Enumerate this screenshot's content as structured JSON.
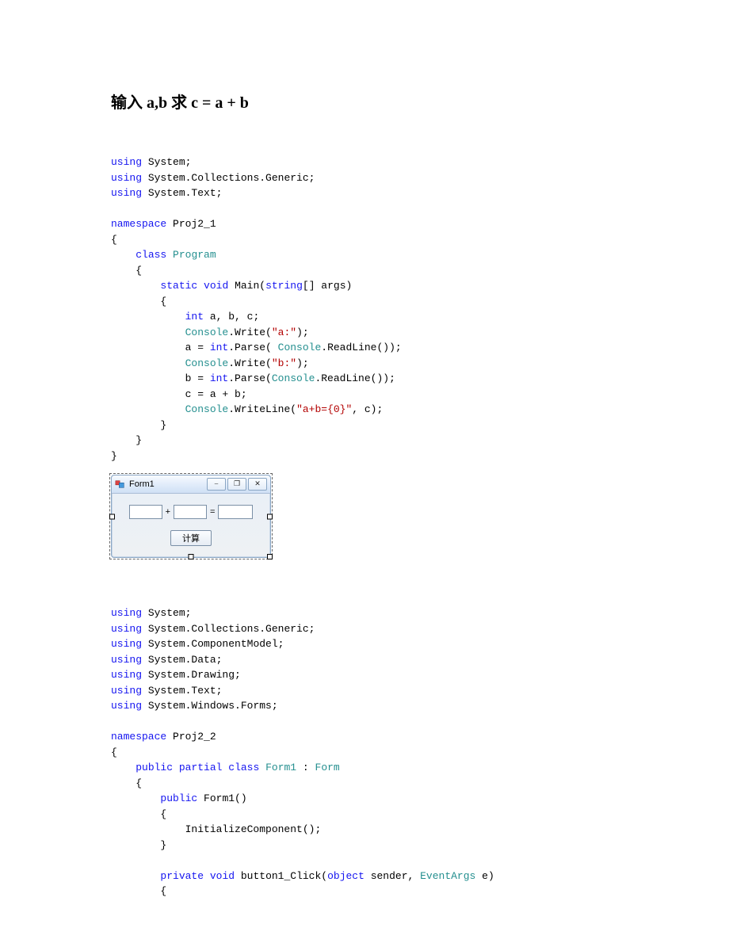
{
  "heading": "输入 a,b 求 c = a + b",
  "code1": {
    "lines": [
      [
        [
          "kw",
          "using"
        ],
        [
          "txt",
          " System;"
        ]
      ],
      [
        [
          "kw",
          "using"
        ],
        [
          "txt",
          " System.Collections.Generic;"
        ]
      ],
      [
        [
          "kw",
          "using"
        ],
        [
          "txt",
          " System.Text;"
        ]
      ],
      [
        [
          "txt",
          ""
        ]
      ],
      [
        [
          "kw",
          "namespace"
        ],
        [
          "txt",
          " Proj2_1"
        ]
      ],
      [
        [
          "txt",
          "{"
        ]
      ],
      [
        [
          "txt",
          "    "
        ],
        [
          "kw",
          "class"
        ],
        [
          "txt",
          " "
        ],
        [
          "typ",
          "Program"
        ]
      ],
      [
        [
          "txt",
          "    {"
        ]
      ],
      [
        [
          "txt",
          "        "
        ],
        [
          "kw",
          "static"
        ],
        [
          "txt",
          " "
        ],
        [
          "kw",
          "void"
        ],
        [
          "txt",
          " Main("
        ],
        [
          "kw",
          "string"
        ],
        [
          "txt",
          "[] args)"
        ]
      ],
      [
        [
          "txt",
          "        {"
        ]
      ],
      [
        [
          "txt",
          "            "
        ],
        [
          "kw",
          "int"
        ],
        [
          "txt",
          " a, b, c;"
        ]
      ],
      [
        [
          "txt",
          "            "
        ],
        [
          "typ",
          "Console"
        ],
        [
          "txt",
          ".Write("
        ],
        [
          "str",
          "\"a:\""
        ],
        [
          "txt",
          ");"
        ]
      ],
      [
        [
          "txt",
          "            a = "
        ],
        [
          "kw",
          "int"
        ],
        [
          "txt",
          ".Parse( "
        ],
        [
          "typ",
          "Console"
        ],
        [
          "txt",
          ".ReadLine());"
        ]
      ],
      [
        [
          "txt",
          "            "
        ],
        [
          "typ",
          "Console"
        ],
        [
          "txt",
          ".Write("
        ],
        [
          "str",
          "\"b:\""
        ],
        [
          "txt",
          ");"
        ]
      ],
      [
        [
          "txt",
          "            b = "
        ],
        [
          "kw",
          "int"
        ],
        [
          "txt",
          ".Parse("
        ],
        [
          "typ",
          "Console"
        ],
        [
          "txt",
          ".ReadLine());"
        ]
      ],
      [
        [
          "txt",
          "            c = a + b;"
        ]
      ],
      [
        [
          "txt",
          "            "
        ],
        [
          "typ",
          "Console"
        ],
        [
          "txt",
          ".WriteLine("
        ],
        [
          "str",
          "\"a+b={0}\""
        ],
        [
          "txt",
          ", c);"
        ]
      ],
      [
        [
          "txt",
          "        }"
        ]
      ],
      [
        [
          "txt",
          "    }"
        ]
      ],
      [
        [
          "txt",
          "}"
        ]
      ]
    ]
  },
  "form": {
    "title": "Form1",
    "plus": "+",
    "equals": "=",
    "button": "计算",
    "min_glyph": "⎯",
    "max_glyph": "❐",
    "close_glyph": "✕"
  },
  "code2": {
    "lines": [
      [
        [
          "kw",
          "using"
        ],
        [
          "txt",
          " System;"
        ]
      ],
      [
        [
          "kw",
          "using"
        ],
        [
          "txt",
          " System.Collections.Generic;"
        ]
      ],
      [
        [
          "kw",
          "using"
        ],
        [
          "txt",
          " System.ComponentModel;"
        ]
      ],
      [
        [
          "kw",
          "using"
        ],
        [
          "txt",
          " System.Data;"
        ]
      ],
      [
        [
          "kw",
          "using"
        ],
        [
          "txt",
          " System.Drawing;"
        ]
      ],
      [
        [
          "kw",
          "using"
        ],
        [
          "txt",
          " System.Text;"
        ]
      ],
      [
        [
          "kw",
          "using"
        ],
        [
          "txt",
          " System.Windows.Forms;"
        ]
      ],
      [
        [
          "txt",
          ""
        ]
      ],
      [
        [
          "kw",
          "namespace"
        ],
        [
          "txt",
          " Proj2_2"
        ]
      ],
      [
        [
          "txt",
          "{"
        ]
      ],
      [
        [
          "txt",
          "    "
        ],
        [
          "kw",
          "public"
        ],
        [
          "txt",
          " "
        ],
        [
          "kw",
          "partial"
        ],
        [
          "txt",
          " "
        ],
        [
          "kw",
          "class"
        ],
        [
          "txt",
          " "
        ],
        [
          "typ",
          "Form1"
        ],
        [
          "txt",
          " : "
        ],
        [
          "typ",
          "Form"
        ]
      ],
      [
        [
          "txt",
          "    {"
        ]
      ],
      [
        [
          "txt",
          "        "
        ],
        [
          "kw",
          "public"
        ],
        [
          "txt",
          " Form1()"
        ]
      ],
      [
        [
          "txt",
          "        {"
        ]
      ],
      [
        [
          "txt",
          "            InitializeComponent();"
        ]
      ],
      [
        [
          "txt",
          "        }"
        ]
      ],
      [
        [
          "txt",
          ""
        ]
      ],
      [
        [
          "txt",
          "        "
        ],
        [
          "kw",
          "private"
        ],
        [
          "txt",
          " "
        ],
        [
          "kw",
          "void"
        ],
        [
          "txt",
          " button1_Click("
        ],
        [
          "kw",
          "object"
        ],
        [
          "txt",
          " sender, "
        ],
        [
          "typ",
          "EventArgs"
        ],
        [
          "txt",
          " e)"
        ]
      ],
      [
        [
          "txt",
          "        {"
        ]
      ]
    ]
  }
}
